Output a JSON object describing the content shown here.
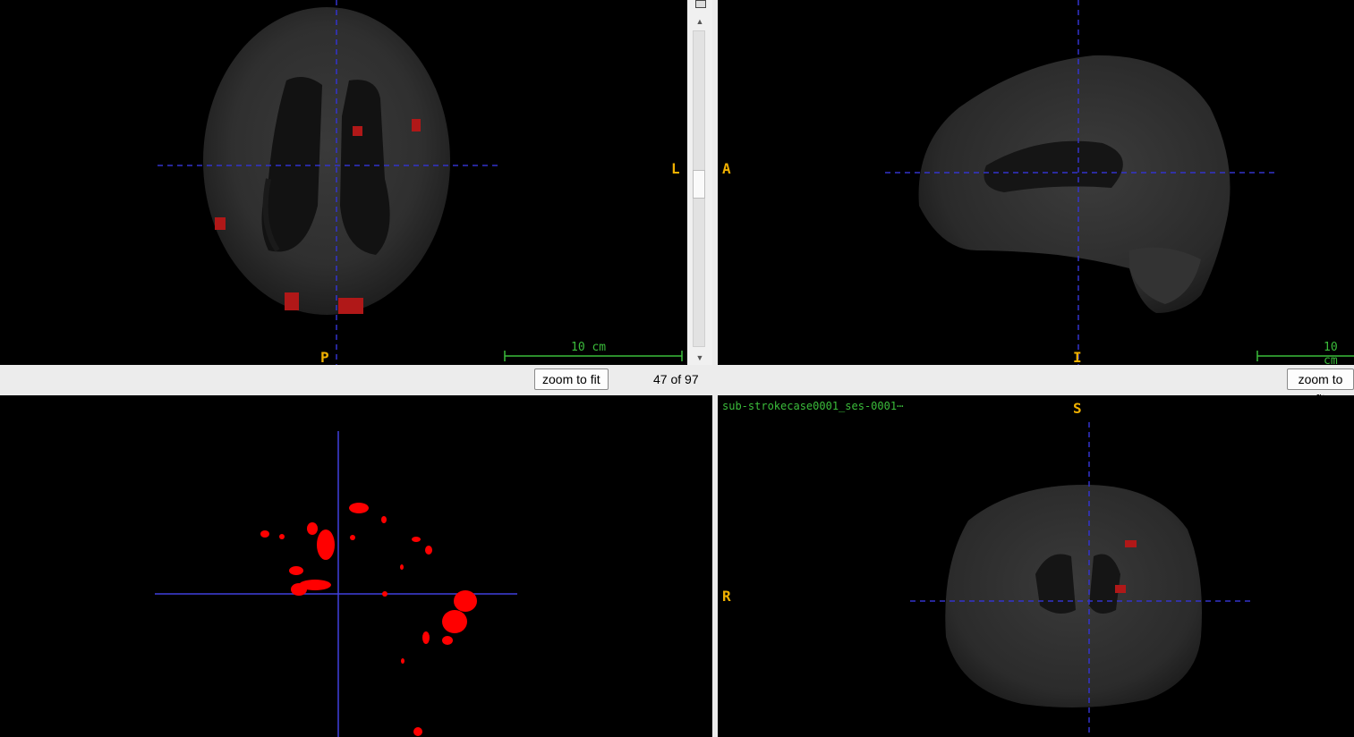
{
  "axial": {
    "label_left": "L",
    "label_bottom": "P",
    "scale_label": "10 cm"
  },
  "sagittal": {
    "label_left": "A",
    "label_bottom": "I",
    "scale_label": "10 cm"
  },
  "coronal": {
    "label_top": "S",
    "label_left": "R",
    "filename": "sub-strokecase0001_ses-0001⋯"
  },
  "controls": {
    "zoom_label_1": "zoom to fit",
    "zoom_label_2": "zoom to fit",
    "slice_text": "47 of 97"
  },
  "scrollbar": {
    "up_icon": "triangle-up-icon",
    "down_icon": "triangle-down-icon",
    "position_fraction": 0.48
  },
  "colors": {
    "crosshair": "#3333cc",
    "lesion": "#b01818",
    "lesion_3d": "#ff0000",
    "orientation_label": "#f0b000",
    "scalebar": "#3bbd3b"
  }
}
